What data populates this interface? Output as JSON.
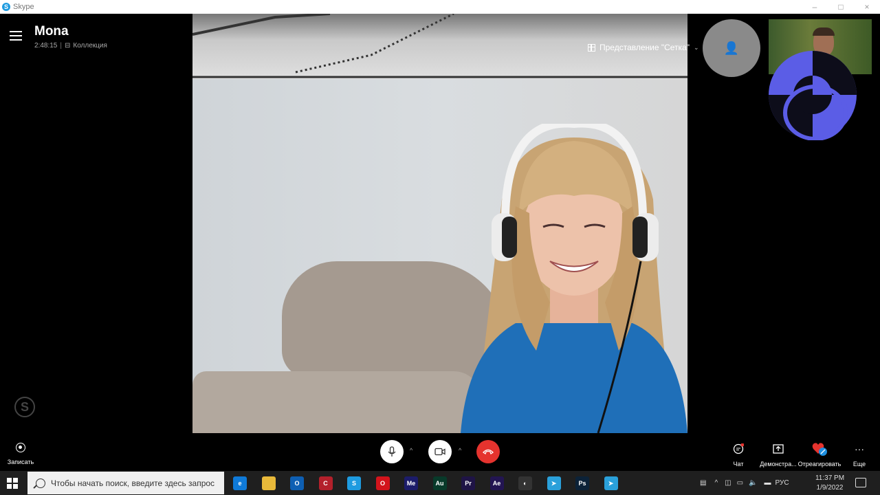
{
  "window": {
    "app_title": "Skype",
    "app_icon_glyph": "S",
    "controls": {
      "minimize": "–",
      "maximize": "□",
      "close": "×"
    }
  },
  "call": {
    "contact_name": "Mona",
    "duration": "2:48:15",
    "separator": "|",
    "collection_label": "Коллекция"
  },
  "view": {
    "label": "Представление \"Сетка\""
  },
  "controls": {
    "record_label": "Записать",
    "chat_label": "Чат",
    "share_label": "Демонстра...",
    "react_label": "Отреагировать",
    "more_label": "Еще"
  },
  "taskbar": {
    "search_placeholder": "Чтобы начать поиск, введите здесь запрос",
    "apps": [
      {
        "name": "edge",
        "glyph": "e",
        "color": "#0f7ad8"
      },
      {
        "name": "file-explorer",
        "glyph": "",
        "color": "#e8b93a"
      },
      {
        "name": "outlook",
        "glyph": "O",
        "color": "#0e5fb3"
      },
      {
        "name": "ccleaner",
        "glyph": "C",
        "color": "#b3202b"
      },
      {
        "name": "skype",
        "glyph": "S",
        "color": "#1e9be0"
      },
      {
        "name": "opera",
        "glyph": "O",
        "color": "#d3141c"
      },
      {
        "name": "media-encoder",
        "glyph": "Me",
        "color": "#1c1c6a"
      },
      {
        "name": "audition",
        "glyph": "Au",
        "color": "#083a2a"
      },
      {
        "name": "premiere",
        "glyph": "Pr",
        "color": "#1f1446"
      },
      {
        "name": "after-effects",
        "glyph": "Ae",
        "color": "#231552"
      },
      {
        "name": "obs",
        "glyph": "◐",
        "color": "#333333"
      },
      {
        "name": "telegram",
        "glyph": "➤",
        "color": "#2aa0da"
      },
      {
        "name": "photoshop",
        "glyph": "Ps",
        "color": "#0c2238"
      },
      {
        "name": "telegram-desktop",
        "glyph": "➤",
        "color": "#2aa0da"
      }
    ],
    "language": "РУС",
    "time": "11:37 PM",
    "date": "1/9/2022"
  }
}
